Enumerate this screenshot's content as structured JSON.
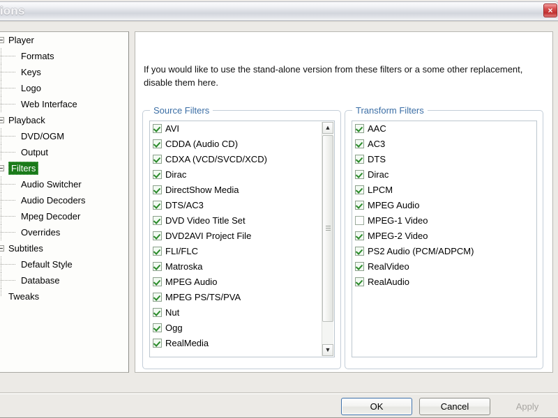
{
  "window": {
    "title": "tions",
    "close_icon": "close-icon",
    "close_glyph": "×"
  },
  "sidebar": {
    "items": [
      {
        "label": "Player",
        "depth": 0,
        "expander": true,
        "selected": false
      },
      {
        "label": "Formats",
        "depth": 1,
        "expander": false,
        "selected": false
      },
      {
        "label": "Keys",
        "depth": 1,
        "expander": false,
        "selected": false
      },
      {
        "label": "Logo",
        "depth": 1,
        "expander": false,
        "selected": false
      },
      {
        "label": "Web Interface",
        "depth": 1,
        "expander": false,
        "selected": false
      },
      {
        "label": "Playback",
        "depth": 0,
        "expander": true,
        "selected": false
      },
      {
        "label": "DVD/OGM",
        "depth": 1,
        "expander": false,
        "selected": false
      },
      {
        "label": "Output",
        "depth": 1,
        "expander": false,
        "selected": false
      },
      {
        "label": "Filters",
        "depth": 0,
        "expander": true,
        "selected": true
      },
      {
        "label": "Audio Switcher",
        "depth": 1,
        "expander": false,
        "selected": false
      },
      {
        "label": "Audio Decoders",
        "depth": 1,
        "expander": false,
        "selected": false
      },
      {
        "label": "Mpeg Decoder",
        "depth": 1,
        "expander": false,
        "selected": false
      },
      {
        "label": "Overrides",
        "depth": 1,
        "expander": false,
        "selected": false
      },
      {
        "label": "Subtitles",
        "depth": 0,
        "expander": true,
        "selected": false
      },
      {
        "label": "Default Style",
        "depth": 1,
        "expander": false,
        "selected": false
      },
      {
        "label": "Database",
        "depth": 1,
        "expander": false,
        "selected": false
      },
      {
        "label": "Tweaks",
        "depth": 0,
        "expander": false,
        "selected": false
      }
    ]
  },
  "main": {
    "description": "If you would like to use the stand-alone version from these filters or a some other replacement, disable them here.",
    "source_filters": {
      "legend": "Source Filters",
      "has_scrollbar": true,
      "scroll_up_glyph": "▲",
      "scroll_down_glyph": "▼",
      "items": [
        {
          "label": "AVI",
          "checked": true
        },
        {
          "label": "CDDA (Audio CD)",
          "checked": true
        },
        {
          "label": "CDXA (VCD/SVCD/XCD)",
          "checked": true
        },
        {
          "label": "Dirac",
          "checked": true
        },
        {
          "label": "DirectShow Media",
          "checked": true
        },
        {
          "label": "DTS/AC3",
          "checked": true
        },
        {
          "label": "DVD Video Title Set",
          "checked": true
        },
        {
          "label": "DVD2AVI Project File",
          "checked": true
        },
        {
          "label": "FLI/FLC",
          "checked": true
        },
        {
          "label": "Matroska",
          "checked": true
        },
        {
          "label": "MPEG Audio",
          "checked": true
        },
        {
          "label": "MPEG PS/TS/PVA",
          "checked": true
        },
        {
          "label": "Nut",
          "checked": true
        },
        {
          "label": "Ogg",
          "checked": true
        },
        {
          "label": "RealMedia",
          "checked": true
        }
      ]
    },
    "transform_filters": {
      "legend": "Transform Filters",
      "has_scrollbar": false,
      "items": [
        {
          "label": "AAC",
          "checked": true
        },
        {
          "label": "AC3",
          "checked": true
        },
        {
          "label": "DTS",
          "checked": true
        },
        {
          "label": "Dirac",
          "checked": true
        },
        {
          "label": "LPCM",
          "checked": true
        },
        {
          "label": "MPEG Audio",
          "checked": true
        },
        {
          "label": "MPEG-1 Video",
          "checked": false
        },
        {
          "label": "MPEG-2 Video",
          "checked": true
        },
        {
          "label": "PS2 Audio (PCM/ADPCM)",
          "checked": true
        },
        {
          "label": "RealVideo",
          "checked": true
        },
        {
          "label": "RealAudio",
          "checked": true
        }
      ]
    }
  },
  "footer": {
    "ok_label": "OK",
    "cancel_label": "Cancel",
    "apply_label": "Apply",
    "apply_enabled": false
  },
  "colors": {
    "selection_green": "#1a7a1a",
    "legend_blue": "#3b6ea5",
    "check_green": "#2a8a2a",
    "dialog_bg": "#eceae6",
    "close_red": "#c03030"
  }
}
